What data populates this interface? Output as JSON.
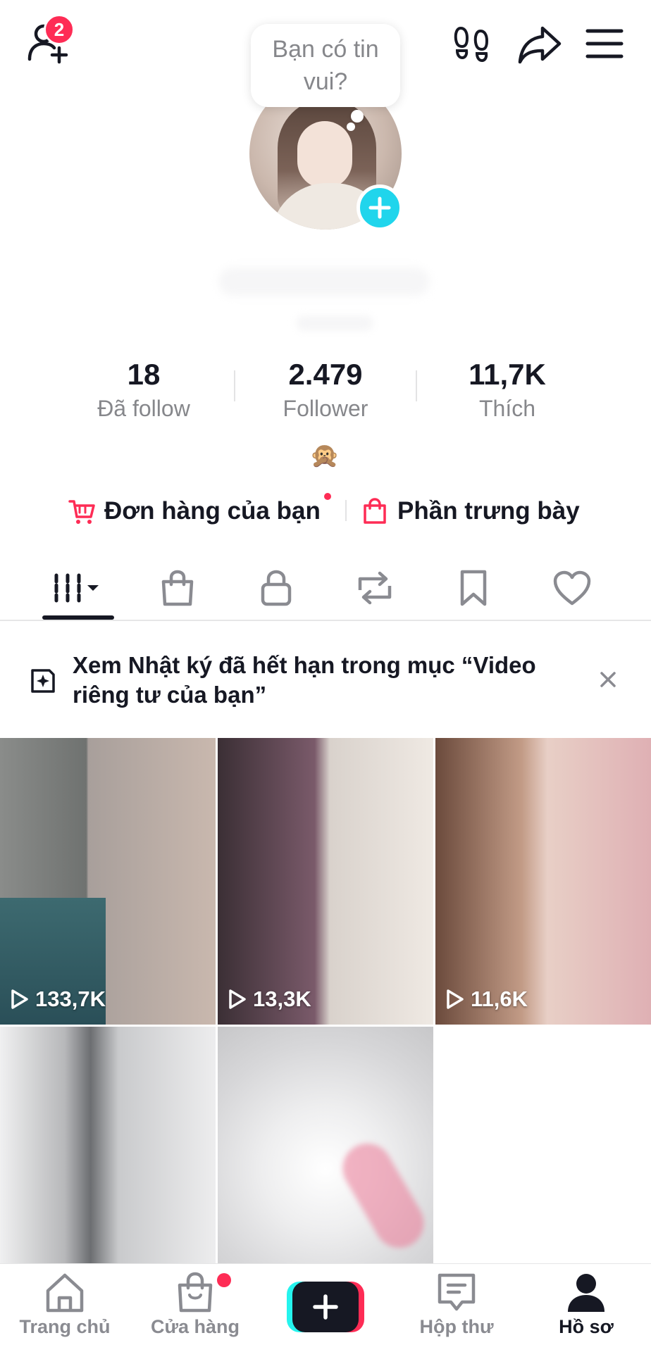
{
  "topbar": {
    "friend_badge_count": "2",
    "icons": [
      "add-friend-icon",
      "footprints-icon",
      "share-icon",
      "menu-icon"
    ]
  },
  "profile": {
    "note_bubble": "Bạn có tin vui?"
  },
  "stats": [
    {
      "value": "18",
      "label": "Đã follow"
    },
    {
      "value": "2.479",
      "label": "Follower"
    },
    {
      "value": "11,7K",
      "label": "Thích"
    }
  ],
  "bio_emoji": "🙊",
  "shop_links": {
    "orders": "Đơn hàng của bạn",
    "showcase": "Phần trưng bày"
  },
  "tabs": [
    "videos-tab",
    "shop-tab",
    "private-tab",
    "repost-tab",
    "saved-tab",
    "liked-tab"
  ],
  "notice": {
    "text": "Xem Nhật ký đã hết hạn trong mục “Video riêng tư của bạn”"
  },
  "videos": [
    {
      "views": "133,7K"
    },
    {
      "views": "13,3K"
    },
    {
      "views": "11,6K"
    },
    {
      "views": ""
    },
    {
      "views": ""
    }
  ],
  "bottom_nav": {
    "home": "Trang chủ",
    "shop": "Cửa hàng",
    "inbox": "Hộp thư",
    "profile": "Hồ sơ"
  },
  "colors": {
    "accent": "#fe2c55",
    "cyan": "#20d5ec",
    "text": "#161823",
    "muted": "#86878b"
  }
}
